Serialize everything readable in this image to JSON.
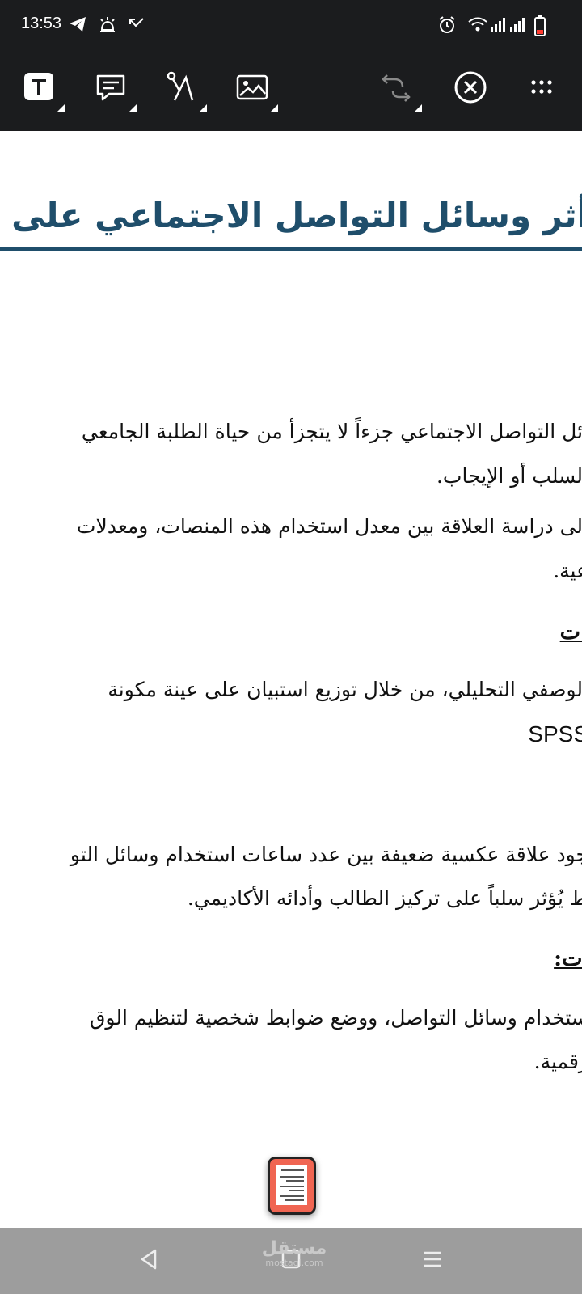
{
  "status_bar": {
    "time": "13:53",
    "left_icons": [
      "telegram-icon",
      "bell-ring-icon",
      "missed-call-icon"
    ],
    "right_icons": [
      "alarm-icon",
      "wifi-icon",
      "signal-icon",
      "signal-icon",
      "battery-low-icon"
    ]
  },
  "toolbar": {
    "tools": [
      "text-tool-icon",
      "comment-tool-icon",
      "draw-tool-icon",
      "image-tool-icon",
      "undo-redo-icon",
      "close-circle-icon",
      "more-icon"
    ]
  },
  "document": {
    "title": "أثر وسائل التواصل الاجتماعي على الت",
    "paragraphs": [
      "ائل التواصل الاجتماعي جزءاً لا يتجزأ من حياة الطلبة الجامعي",
      "السلب أو الإيجاب.",
      "إلى دراسة العلاقة بين معدل استخدام هذه المنصات، ومعدلات",
      "عية.",
      "الوصفي التحليلي، من خلال توزيع استبيان على عينة مكونة",
      "SPSS",
      "جود علاقة عكسية ضعيفة بين عدد ساعات استخدام وسائل التو",
      "ط يُؤثر سلباً على تركيز الطالب وأدائه الأكاديمي.",
      "ستخدام وسائل التواصل، ووضع ضوابط شخصية لتنظيم الوق",
      "رقمية."
    ],
    "headings": [
      ":ت",
      "ات:"
    ]
  },
  "watermark": {
    "arabic": "مستقل",
    "latin": "mostaql.com"
  },
  "colors": {
    "bar": "#1b1c1e",
    "title": "#1f4e6b",
    "navbar": "#9d9d9d",
    "thumbnail": "#f06552"
  }
}
